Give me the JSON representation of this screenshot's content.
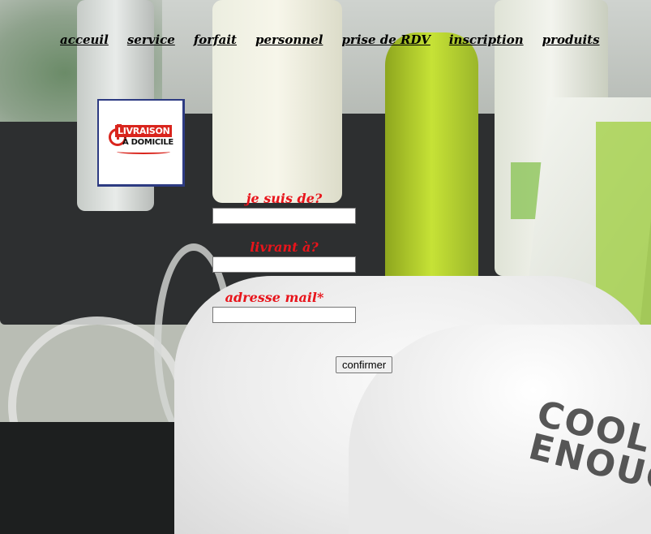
{
  "nav": {
    "items": [
      {
        "label": "acceuil"
      },
      {
        "label": "service"
      },
      {
        "label": "forfait"
      },
      {
        "label": "personnel"
      },
      {
        "label": "prise de RDV"
      },
      {
        "label": "inscription"
      },
      {
        "label": "produits"
      }
    ]
  },
  "logo": {
    "line1": "LIVRAISON",
    "line2": "À DOMICILE"
  },
  "form": {
    "from_label": "je suis de?",
    "from_value": "",
    "to_label": "livrant à?",
    "to_value": "",
    "email_label": "adresse mail*",
    "email_value": "",
    "submit_label": "confirmer"
  },
  "background": {
    "product_text": "COOL ENOUGH"
  },
  "colors": {
    "label_red": "#e8141b",
    "nav_text": "#000000"
  }
}
